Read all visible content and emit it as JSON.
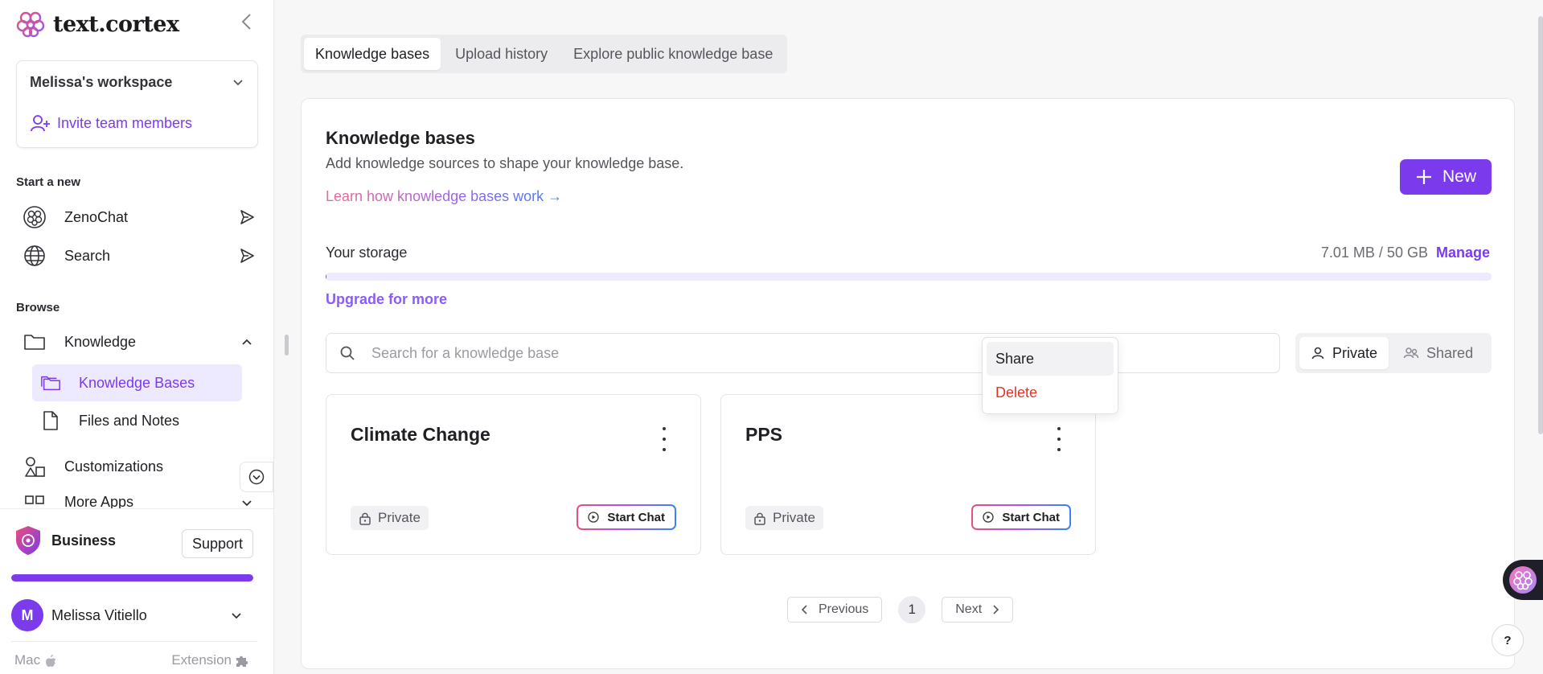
{
  "app": {
    "logo_text": "text.cortex",
    "brand_color": "#7c3aed"
  },
  "workspace": {
    "name": "Melissa's workspace",
    "invite_label": "Invite team members"
  },
  "sidebar": {
    "start_section_label": "Start a new",
    "start_items": [
      {
        "label": "ZenoChat",
        "icon": "brain-icon",
        "action_icon": "send-icon"
      },
      {
        "label": "Search",
        "icon": "globe-icon",
        "action_icon": "send-icon"
      }
    ],
    "browse_section_label": "Browse",
    "knowledge": {
      "label": "Knowledge",
      "icon": "folder-icon",
      "sub_items": [
        {
          "label": "Knowledge Bases",
          "icon": "folders-icon",
          "active": true
        },
        {
          "label": "Files and Notes",
          "icon": "file-icon",
          "active": false
        }
      ]
    },
    "customizations_label": "Customizations",
    "more_apps_label": "More Apps",
    "plan_name": "Business",
    "support_label": "Support",
    "usage_fraction": 1.0,
    "user": {
      "initial": "M",
      "name": "Melissa Vitiello"
    },
    "footer_left": "Mac",
    "footer_right": "Extension"
  },
  "tabs": [
    {
      "label": "Knowledge bases",
      "active": true
    },
    {
      "label": "Upload history",
      "active": false
    },
    {
      "label": "Explore public knowledge base",
      "active": false
    }
  ],
  "main": {
    "title": "Knowledge bases",
    "subtitle": "Add knowledge sources to shape your knowledge base.",
    "learn_link": "Learn how knowledge bases work →",
    "new_button": "New",
    "storage_label": "Your storage",
    "storage_used": "7.01 MB / 50 GB",
    "storage_fraction": 0.0002,
    "manage_label": "Manage",
    "upgrade_label": "Upgrade for more",
    "search_placeholder": "Search for a knowledge base",
    "search_value": "",
    "filter_options": [
      {
        "label": "Private",
        "active": true
      },
      {
        "label": "Shared",
        "active": false
      }
    ],
    "cards": [
      {
        "title": "Climate Change",
        "visibility": "Private",
        "chat_label": "Start Chat"
      },
      {
        "title": "PPS",
        "visibility": "Private",
        "chat_label": "Start Chat"
      }
    ],
    "context_menu": [
      {
        "label": "Share"
      },
      {
        "label": "Delete"
      }
    ],
    "pagination": {
      "prev": "Previous",
      "page": "1",
      "next": "Next"
    },
    "help_label": "?"
  }
}
